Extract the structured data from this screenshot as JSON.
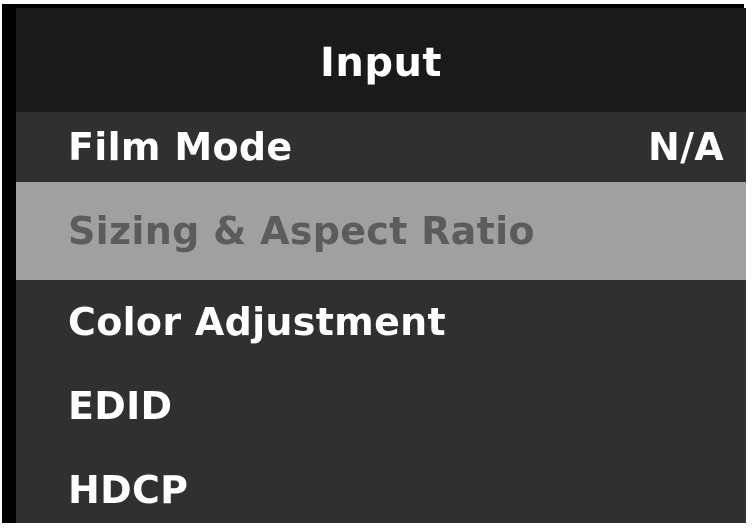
{
  "menu": {
    "title": "Input",
    "items": [
      {
        "label": "Film Mode",
        "value": "N/A",
        "selected": false
      },
      {
        "label": "Sizing & Aspect Ratio",
        "value": "",
        "selected": true
      },
      {
        "label": "Color Adjustment",
        "value": "",
        "selected": false
      },
      {
        "label": "EDID",
        "value": "",
        "selected": false
      },
      {
        "label": "HDCP",
        "value": "",
        "selected": false
      }
    ]
  },
  "colors": {
    "header_background": "#1a1a1a",
    "menu_background": "#303030",
    "selected_background": "#a0a0a0",
    "selected_text": "#5c5c5c",
    "text": "#ffffff"
  }
}
